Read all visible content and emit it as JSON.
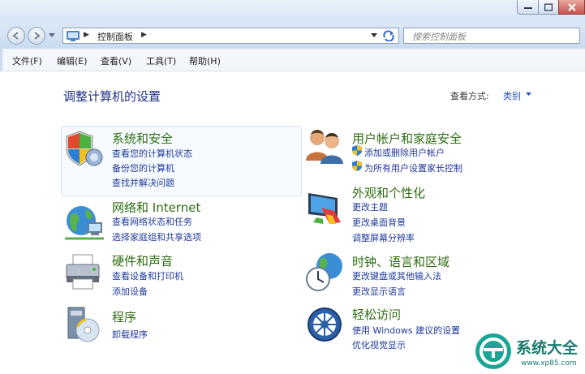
{
  "titlebar": {
    "buttons": [
      "minimize",
      "maximize",
      "close"
    ]
  },
  "nav": {
    "address_path": "控制面板",
    "search_placeholder": "搜索控制面板"
  },
  "menubar": {
    "items": [
      "文件(F)",
      "编辑(E)",
      "查看(V)",
      "工具(T)",
      "帮助(H)"
    ]
  },
  "content": {
    "page_title": "调整计算机的设置",
    "view_by_label": "查看方式:",
    "view_by_value": "类别",
    "categories": [
      {
        "title": "系统和安全",
        "icon": "shield-icon",
        "links": [
          "查看您的计算机状态",
          "备份您的计算机",
          "查找并解决问题"
        ]
      },
      {
        "title": "网络和 Internet",
        "icon": "network-globe-icon",
        "links": [
          "查看网络状态和任务",
          "选择家庭组和共享选项"
        ]
      },
      {
        "title": "硬件和声音",
        "icon": "printer-icon",
        "links": [
          "查看设备和打印机",
          "添加设备"
        ]
      },
      {
        "title": "程序",
        "icon": "programs-icon",
        "links": [
          "卸载程序"
        ]
      },
      {
        "title": "用户帐户和家庭安全",
        "icon": "users-icon",
        "links": [
          "添加或删除用户帐户",
          "为所有用户设置家长控制"
        ]
      },
      {
        "title": "外观和个性化",
        "icon": "monitor-paint-icon",
        "links": [
          "更改主题",
          "更改桌面背景",
          "调整屏幕分辨率"
        ]
      },
      {
        "title": "时钟、语言和区域",
        "icon": "clock-globe-icon",
        "links": [
          "更改键盘或其他输入法",
          "更改显示语言"
        ]
      },
      {
        "title": "轻松访问",
        "icon": "ease-of-access-icon",
        "links": [
          "使用 Windows 建议的设置",
          "优化视觉显示"
        ]
      }
    ]
  },
  "watermark": {
    "text": "系统大全",
    "sub": "www.xp85.com"
  },
  "colors": {
    "category_title": "#2d6e12",
    "link": "#1e3a9c",
    "page_title": "#1e3287",
    "watermark": "#1aa596"
  }
}
